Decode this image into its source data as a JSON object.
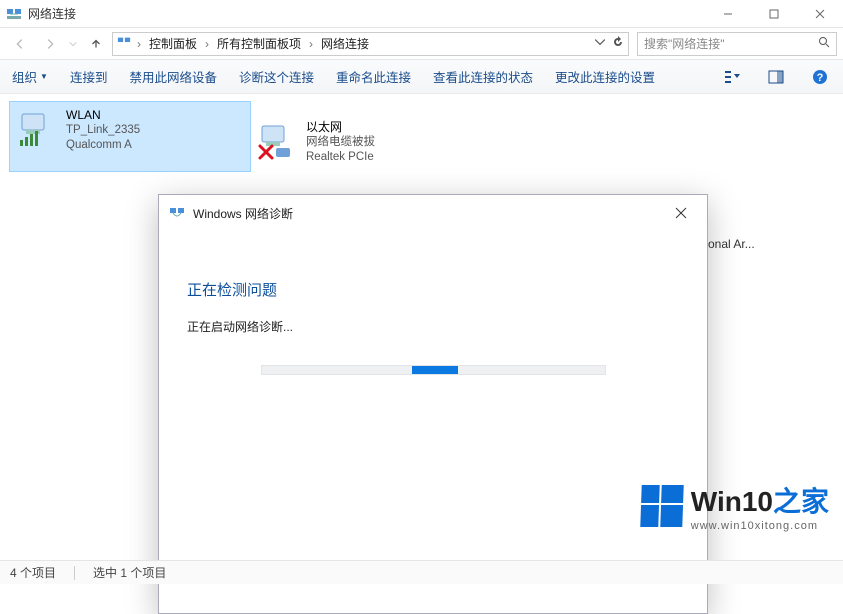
{
  "window": {
    "title": "网络连接",
    "controls": {
      "minimize_name": "minimize",
      "maximize_name": "maximize",
      "close_name": "close"
    }
  },
  "breadcrumb": {
    "items": [
      "控制面板",
      "所有控制面板项",
      "网络连接"
    ]
  },
  "search": {
    "placeholder": "搜索\"网络连接\""
  },
  "toolbar": {
    "items": [
      "组织",
      "连接到",
      "禁用此网络设备",
      "诊断这个连接",
      "重命名此连接",
      "查看此连接的状态",
      "更改此连接的设置"
    ]
  },
  "adapters": [
    {
      "name": "WLAN",
      "line2": "TP_Link_2335",
      "line3": "Qualcomm A",
      "selected": true,
      "type": "wifi"
    },
    {
      "name": "以太网",
      "line2": "网络电缆被拔",
      "line3": "Realtek PCIe",
      "selected": false,
      "type": "ethernet-unplugged"
    }
  ],
  "truncated_adapter_text": "onal Ar...",
  "dialog": {
    "title": "Windows 网络诊断",
    "heading": "正在检测问题",
    "status": "正在启动网络诊断..."
  },
  "statusbar": {
    "count": "4 个项目",
    "selected": "选中 1 个项目"
  },
  "watermark": {
    "brand1": "Win10",
    "brand2": "之家",
    "url": "www.win10xitong.com"
  }
}
